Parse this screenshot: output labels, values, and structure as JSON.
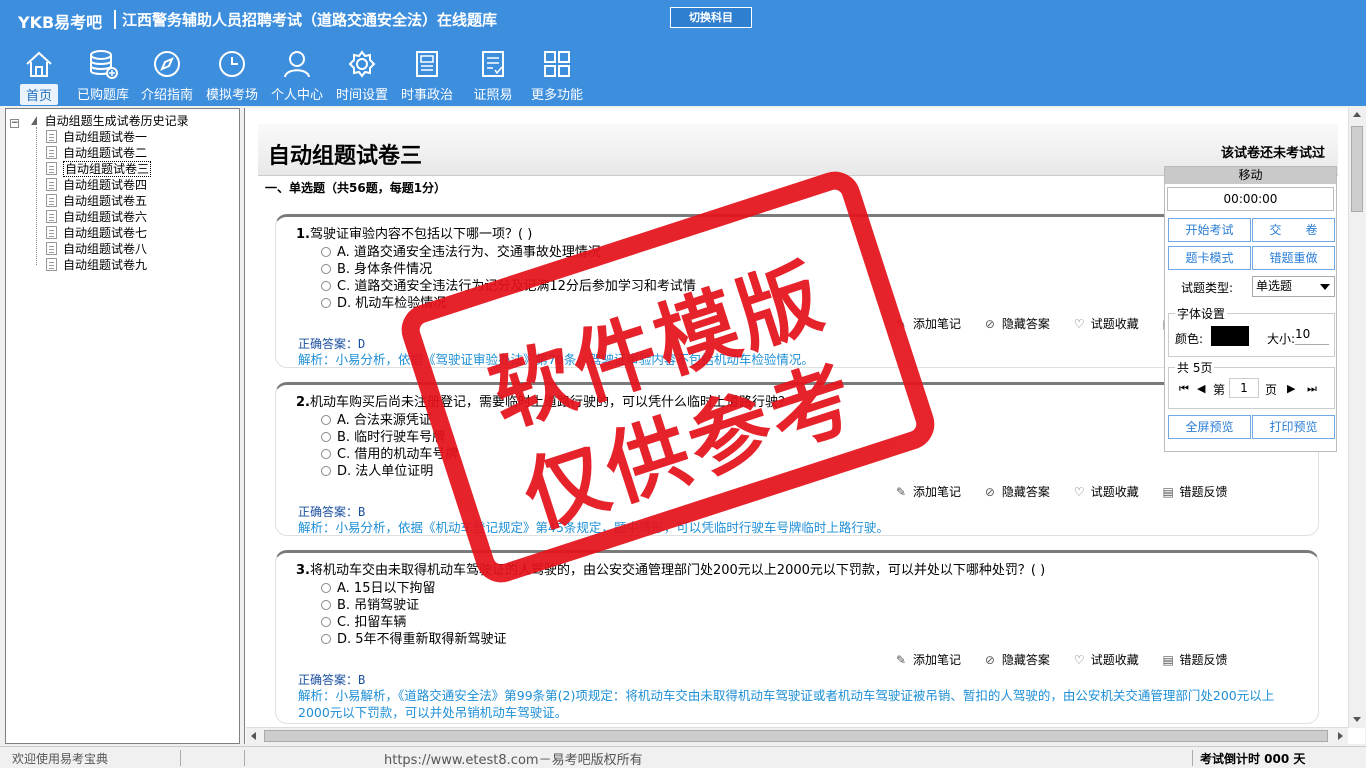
{
  "header": {
    "logo": "YKB易考吧",
    "title": "江西警务辅助人员招聘考试（道路交通安全法）在线题库",
    "switch_subject": "切换科目"
  },
  "nav": [
    {
      "label": "首页",
      "icon": "home-icon"
    },
    {
      "label": "已购题库",
      "icon": "database-icon"
    },
    {
      "label": "介绍指南",
      "icon": "compass-icon"
    },
    {
      "label": "模拟考场",
      "icon": "clock-icon"
    },
    {
      "label": "个人中心",
      "icon": "user-icon"
    },
    {
      "label": "时间设置",
      "icon": "gear-icon"
    },
    {
      "label": "时事政治",
      "icon": "news-icon"
    },
    {
      "label": "证照易",
      "icon": "certificate-icon"
    },
    {
      "label": "更多功能",
      "icon": "grid-icon"
    }
  ],
  "tree": {
    "root": "自动组题生成试卷历史记录",
    "items": [
      "自动组题试卷一",
      "自动组题试卷二",
      "自动组题试卷三",
      "自动组题试卷四",
      "自动组题试卷五",
      "自动组题试卷六",
      "自动组题试卷七",
      "自动组题试卷八",
      "自动组题试卷九"
    ],
    "selected_index": 2
  },
  "paper": {
    "title": "自动组题试卷三",
    "status": "该试卷还未考试过",
    "section": "一、单选题（共56题，每题1分）"
  },
  "tools": {
    "note": "添加笔记",
    "hide": "隐藏答案",
    "fav": "试题收藏",
    "report": "错题反馈"
  },
  "questions": [
    {
      "num": "1.",
      "stem": "驾驶证审验内容不包括以下哪一项？( )",
      "options": [
        "A. 道路交通安全违法行为、交通事故处理情况",
        "B. 身体条件情况",
        "C. 道路交通安全违法行为记分及记满12分后参加学习和考试情",
        "D. 机动车检验情况"
      ],
      "answer": "正确答案：D",
      "analysis": "解析：小易分析，依据《驾驶证审验办法》第70条，驾驶证审验内容不包括机动车检验情况。"
    },
    {
      "num": "2.",
      "stem": "机动车购买后尚未注册登记，需要临时上道路行驶的，可以凭什么临时上道路行驶？",
      "options": [
        "A. 合法来源凭证",
        "B. 临时行驶车号牌",
        "C. 借用的机动车号牌",
        "D. 法人单位证明"
      ],
      "answer": "正确答案：B",
      "analysis": "解析：小易分析，依据《机动车登记规定》第45条规定，题中情形，可以凭临时行驶车号牌临时上路行驶。"
    },
    {
      "num": "3.",
      "stem": "将机动车交由未取得机动车驾驶证的人驾驶的，由公安交通管理部门处200元以上2000元以下罚款，可以并处以下哪种处罚？( )",
      "options": [
        "A. 15日以下拘留",
        "B. 吊销驾驶证",
        "C. 扣留车辆",
        "D. 5年不得重新取得新驾驶证"
      ],
      "answer": "正确答案：B",
      "analysis": "解析：小易解析，《道路交通安全法》第99条第(2)项规定：将机动车交由未取得机动车驾驶证或者机动车驾驶证被吊销、暂扣的人驾驶的，由公安机关交通管理部门处200元以上2000元以下罚款，可以并处吊销机动车驾驶证。"
    }
  ],
  "control": {
    "move": "移动",
    "timer": "00:00:00",
    "start_exam": "开始考试",
    "submit": "交　　卷",
    "card_mode": "题卡模式",
    "redo_wrong": "错题重做",
    "type_label": "试题类型:",
    "type_value": "单选题",
    "font_legend": "字体设置",
    "color_label": "颜色:",
    "size_label": "大小:",
    "size_value": "10",
    "pages_legend": "共 5页",
    "page_prefix": "第",
    "page_value": "1",
    "page_suffix": "页",
    "fullscreen": "全屏预览",
    "print": "打印预览"
  },
  "statusbar": {
    "welcome": "欢迎使用易考宝典",
    "copyright": "https://www.etest8.com－易考吧版权所有",
    "countdown": "考试倒计时 000 天"
  },
  "stamp": {
    "line1": "软件模版",
    "line2": "仅供参考"
  },
  "colors": {
    "header_bg": "#3d8fde",
    "stamp_red": "#e5121b",
    "link_blue": "#1e8fd6"
  }
}
